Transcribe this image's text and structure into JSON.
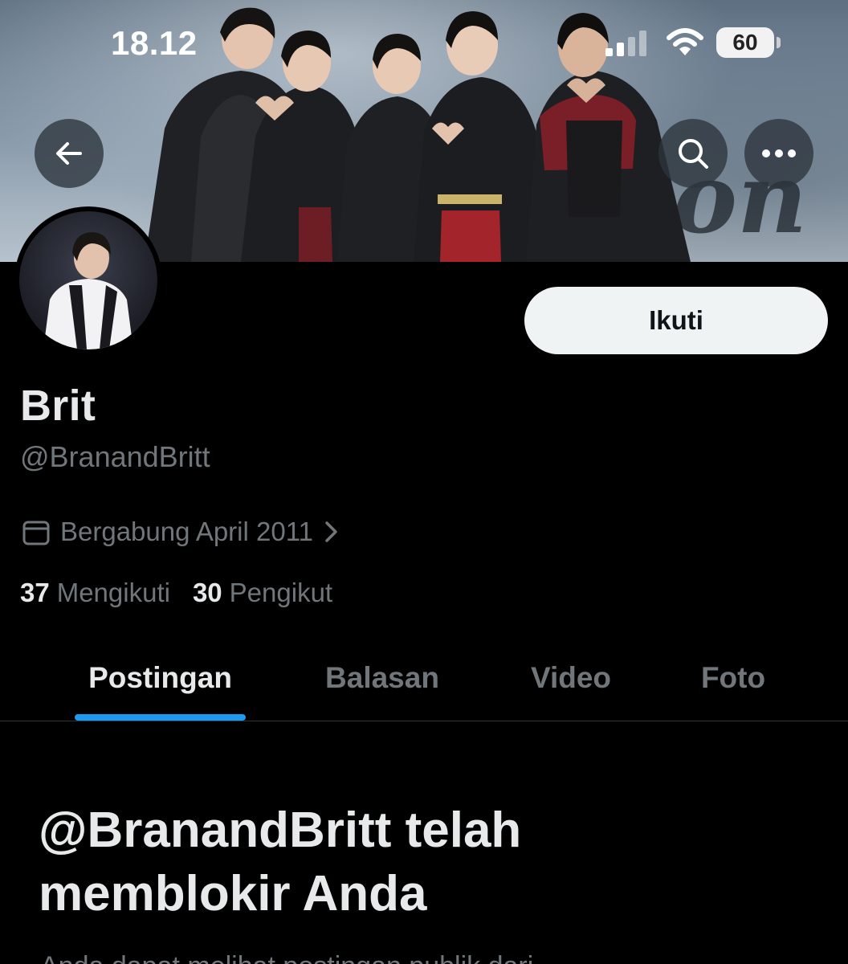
{
  "status_bar": {
    "time": "18.12",
    "battery": "60"
  },
  "header": {
    "back_icon": "arrow-left-icon",
    "search_icon": "search-icon",
    "more_icon": "more-horizontal-icon"
  },
  "banner": {
    "background_text": "on"
  },
  "profile": {
    "display_name": "Brit",
    "handle": "@BranandBritt",
    "joined": "Bergabung April 2011",
    "following_count": "37",
    "following_label": "Mengikuti",
    "followers_count": "30",
    "followers_label": "Pengikut",
    "follow_button": "Ikuti"
  },
  "tabs": [
    {
      "label": "Postingan",
      "active": true
    },
    {
      "label": "Balasan",
      "active": false
    },
    {
      "label": "Video",
      "active": false
    },
    {
      "label": "Foto",
      "active": false
    }
  ],
  "blocked": {
    "title_line1": "@BranandBritt telah",
    "title_line2": "memblokir Anda",
    "description": "Anda dapat melihat postingan publik dari"
  },
  "colors": {
    "background": "#000000",
    "primary_text": "#e7e9ea",
    "secondary_text": "#71767b",
    "accent": "#1d9bf0",
    "follow_button_bg": "#eff3f4"
  }
}
